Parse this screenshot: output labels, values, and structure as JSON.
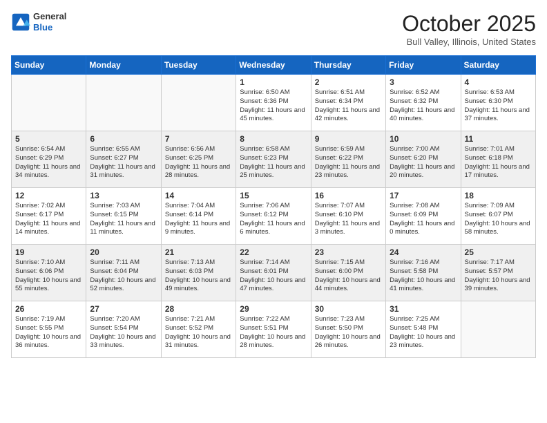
{
  "header": {
    "logo_line1": "General",
    "logo_line2": "Blue",
    "month": "October 2025",
    "location": "Bull Valley, Illinois, United States"
  },
  "weekdays": [
    "Sunday",
    "Monday",
    "Tuesday",
    "Wednesday",
    "Thursday",
    "Friday",
    "Saturday"
  ],
  "weeks": [
    [
      {
        "day": "",
        "empty": true
      },
      {
        "day": "",
        "empty": true
      },
      {
        "day": "",
        "empty": true
      },
      {
        "day": "1",
        "sunrise": "6:50 AM",
        "sunset": "6:36 PM",
        "daylight": "11 hours and 45 minutes."
      },
      {
        "day": "2",
        "sunrise": "6:51 AM",
        "sunset": "6:34 PM",
        "daylight": "11 hours and 42 minutes."
      },
      {
        "day": "3",
        "sunrise": "6:52 AM",
        "sunset": "6:32 PM",
        "daylight": "11 hours and 40 minutes."
      },
      {
        "day": "4",
        "sunrise": "6:53 AM",
        "sunset": "6:30 PM",
        "daylight": "11 hours and 37 minutes."
      }
    ],
    [
      {
        "day": "5",
        "sunrise": "6:54 AM",
        "sunset": "6:29 PM",
        "daylight": "11 hours and 34 minutes."
      },
      {
        "day": "6",
        "sunrise": "6:55 AM",
        "sunset": "6:27 PM",
        "daylight": "11 hours and 31 minutes."
      },
      {
        "day": "7",
        "sunrise": "6:56 AM",
        "sunset": "6:25 PM",
        "daylight": "11 hours and 28 minutes."
      },
      {
        "day": "8",
        "sunrise": "6:58 AM",
        "sunset": "6:23 PM",
        "daylight": "11 hours and 25 minutes."
      },
      {
        "day": "9",
        "sunrise": "6:59 AM",
        "sunset": "6:22 PM",
        "daylight": "11 hours and 23 minutes."
      },
      {
        "day": "10",
        "sunrise": "7:00 AM",
        "sunset": "6:20 PM",
        "daylight": "11 hours and 20 minutes."
      },
      {
        "day": "11",
        "sunrise": "7:01 AM",
        "sunset": "6:18 PM",
        "daylight": "11 hours and 17 minutes."
      }
    ],
    [
      {
        "day": "12",
        "sunrise": "7:02 AM",
        "sunset": "6:17 PM",
        "daylight": "11 hours and 14 minutes."
      },
      {
        "day": "13",
        "sunrise": "7:03 AM",
        "sunset": "6:15 PM",
        "daylight": "11 hours and 11 minutes."
      },
      {
        "day": "14",
        "sunrise": "7:04 AM",
        "sunset": "6:14 PM",
        "daylight": "11 hours and 9 minutes."
      },
      {
        "day": "15",
        "sunrise": "7:06 AM",
        "sunset": "6:12 PM",
        "daylight": "11 hours and 6 minutes."
      },
      {
        "day": "16",
        "sunrise": "7:07 AM",
        "sunset": "6:10 PM",
        "daylight": "11 hours and 3 minutes."
      },
      {
        "day": "17",
        "sunrise": "7:08 AM",
        "sunset": "6:09 PM",
        "daylight": "11 hours and 0 minutes."
      },
      {
        "day": "18",
        "sunrise": "7:09 AM",
        "sunset": "6:07 PM",
        "daylight": "10 hours and 58 minutes."
      }
    ],
    [
      {
        "day": "19",
        "sunrise": "7:10 AM",
        "sunset": "6:06 PM",
        "daylight": "10 hours and 55 minutes."
      },
      {
        "day": "20",
        "sunrise": "7:11 AM",
        "sunset": "6:04 PM",
        "daylight": "10 hours and 52 minutes."
      },
      {
        "day": "21",
        "sunrise": "7:13 AM",
        "sunset": "6:03 PM",
        "daylight": "10 hours and 49 minutes."
      },
      {
        "day": "22",
        "sunrise": "7:14 AM",
        "sunset": "6:01 PM",
        "daylight": "10 hours and 47 minutes."
      },
      {
        "day": "23",
        "sunrise": "7:15 AM",
        "sunset": "6:00 PM",
        "daylight": "10 hours and 44 minutes."
      },
      {
        "day": "24",
        "sunrise": "7:16 AM",
        "sunset": "5:58 PM",
        "daylight": "10 hours and 41 minutes."
      },
      {
        "day": "25",
        "sunrise": "7:17 AM",
        "sunset": "5:57 PM",
        "daylight": "10 hours and 39 minutes."
      }
    ],
    [
      {
        "day": "26",
        "sunrise": "7:19 AM",
        "sunset": "5:55 PM",
        "daylight": "10 hours and 36 minutes."
      },
      {
        "day": "27",
        "sunrise": "7:20 AM",
        "sunset": "5:54 PM",
        "daylight": "10 hours and 33 minutes."
      },
      {
        "day": "28",
        "sunrise": "7:21 AM",
        "sunset": "5:52 PM",
        "daylight": "10 hours and 31 minutes."
      },
      {
        "day": "29",
        "sunrise": "7:22 AM",
        "sunset": "5:51 PM",
        "daylight": "10 hours and 28 minutes."
      },
      {
        "day": "30",
        "sunrise": "7:23 AM",
        "sunset": "5:50 PM",
        "daylight": "10 hours and 26 minutes."
      },
      {
        "day": "31",
        "sunrise": "7:25 AM",
        "sunset": "5:48 PM",
        "daylight": "10 hours and 23 minutes."
      },
      {
        "day": "",
        "empty": true
      }
    ]
  ]
}
